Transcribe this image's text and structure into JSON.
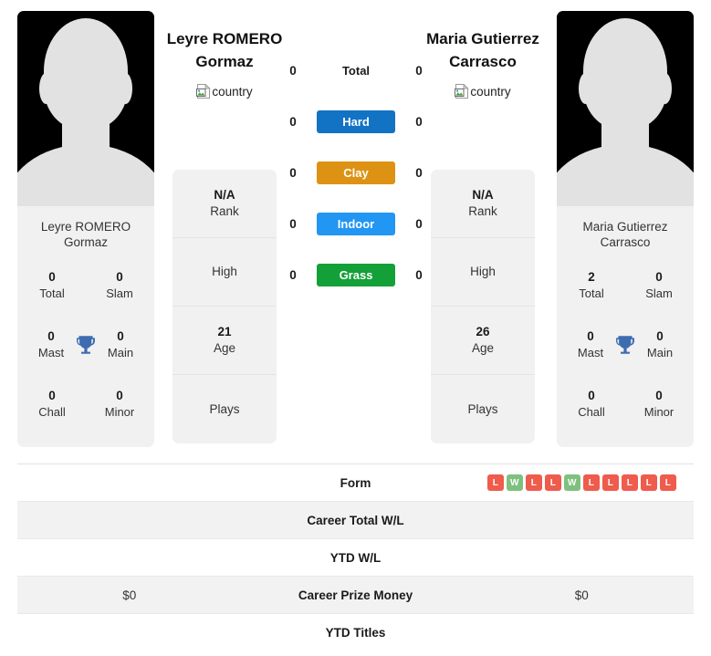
{
  "players": {
    "left": {
      "full_name": "Leyre ROMERO Gormaz",
      "name_line1": "Leyre ROMERO",
      "name_line2": "Gormaz",
      "country_alt": "country",
      "titles": [
        {
          "value": "0",
          "label": "Total"
        },
        {
          "value": "0",
          "label": "Slam"
        },
        {
          "value": "0",
          "label": "Mast"
        },
        {
          "value": "0",
          "label": "Main"
        },
        {
          "value": "0",
          "label": "Chall"
        },
        {
          "value": "0",
          "label": "Minor"
        }
      ],
      "info": [
        {
          "value": "N/A",
          "label": "Rank"
        },
        {
          "value": "",
          "label": "High"
        },
        {
          "value": "21",
          "label": "Age"
        },
        {
          "value": "",
          "label": "Plays"
        }
      ],
      "career_total_wl": "",
      "ytd_wl": "",
      "career_prize_money": "$0",
      "ytd_titles": ""
    },
    "right": {
      "full_name": "Maria Gutierrez Carrasco",
      "name_line1": "Maria Gutierrez",
      "name_line2": "Carrasco",
      "country_alt": "country",
      "titles": [
        {
          "value": "2",
          "label": "Total"
        },
        {
          "value": "0",
          "label": "Slam"
        },
        {
          "value": "0",
          "label": "Mast"
        },
        {
          "value": "0",
          "label": "Main"
        },
        {
          "value": "0",
          "label": "Chall"
        },
        {
          "value": "0",
          "label": "Minor"
        }
      ],
      "info": [
        {
          "value": "N/A",
          "label": "Rank"
        },
        {
          "value": "",
          "label": "High"
        },
        {
          "value": "26",
          "label": "Age"
        },
        {
          "value": "",
          "label": "Plays"
        }
      ],
      "career_total_wl": "",
      "ytd_wl": "",
      "career_prize_money": "$0",
      "ytd_titles": ""
    }
  },
  "surfaces": [
    {
      "label": "Total",
      "left_score": "0",
      "right_score": "0",
      "color": "none",
      "style": "plain"
    },
    {
      "label": "Hard",
      "left_score": "0",
      "right_score": "0",
      "color": "#1273c4",
      "style": "pill"
    },
    {
      "label": "Clay",
      "left_score": "0",
      "right_score": "0",
      "color": "#dd9214",
      "style": "pill"
    },
    {
      "label": "Indoor",
      "left_score": "0",
      "right_score": "0",
      "color": "#2296f3",
      "style": "pill"
    },
    {
      "label": "Grass",
      "left_score": "0",
      "right_score": "0",
      "color": "#14a038",
      "style": "pill"
    }
  ],
  "table_rows": [
    {
      "label": "Form",
      "left": "",
      "right": ""
    },
    {
      "label": "Career Total W/L",
      "left": "",
      "right": ""
    },
    {
      "label": "YTD W/L",
      "left": "",
      "right": ""
    },
    {
      "label": "Career Prize Money",
      "left": "$0",
      "right": "$0"
    },
    {
      "label": "YTD Titles",
      "left": "",
      "right": ""
    }
  ],
  "form": {
    "left_results": [],
    "right_results": [
      "L",
      "W",
      "L",
      "L",
      "W",
      "L",
      "L",
      "L",
      "L",
      "L"
    ]
  },
  "colors": {
    "win": "#7ec17e",
    "loss": "#ef5b4c",
    "hard": "#1273c4",
    "clay": "#dd9214",
    "indoor": "#2296f3",
    "grass": "#14a038",
    "trophy": "#3d6cb0",
    "card_bg": "#f1f1f1",
    "stripe_bg": "#f2f2f2"
  }
}
